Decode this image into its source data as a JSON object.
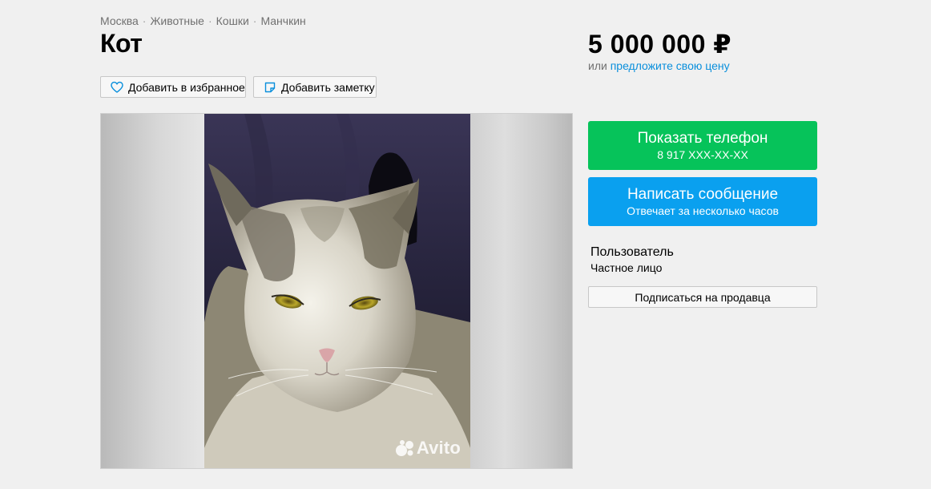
{
  "breadcrumbs": [
    "Москва",
    "Животные",
    "Кошки",
    "Манчкин"
  ],
  "breadcrumb_separator": "·",
  "listing": {
    "title": "Кот",
    "price": "5 000 000 ₽",
    "price_offer_prefix": "или",
    "price_offer_link": "предложите свою цену"
  },
  "actions": {
    "favorite_label": "Добавить в избранное",
    "favorite_icon": "heart-icon",
    "note_label": "Добавить заметку",
    "note_icon": "note-icon"
  },
  "gallery": {
    "watermark_text": "Avito"
  },
  "contact": {
    "phone_button_label": "Показать телефон",
    "phone_masked": "8 917 XXX-XX-XX",
    "message_button_label": "Написать сообщение",
    "message_reply_time": "Отвечает за несколько часов"
  },
  "seller": {
    "name": "Пользователь",
    "type": "Частное лицо",
    "subscribe_label": "Подписаться на продавца"
  },
  "colors": {
    "phone_button": "#06c35a",
    "message_button": "#0aa0ef",
    "link": "#0a8fdc",
    "background": "#f0f0f0"
  }
}
